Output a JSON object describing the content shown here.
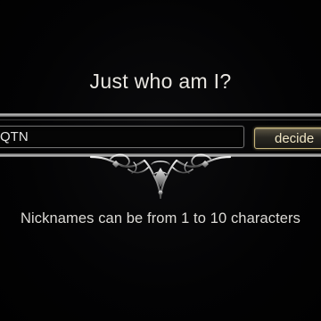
{
  "dialog": {
    "title": "Just who am I?",
    "hint": "Nicknames can be from 1 to 10 characters"
  },
  "nickname_input": {
    "value": "QTN"
  },
  "decide_button": {
    "label": "decide"
  },
  "colors": {
    "background": "#020203",
    "text": "#e9e6e1",
    "button_border": "#c7b57a",
    "frame_line": "#bdbdbd"
  },
  "icons": {
    "ornament": "ornate-silver-filigree-icon"
  }
}
